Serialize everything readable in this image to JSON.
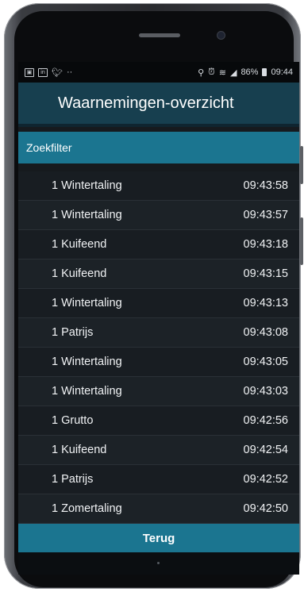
{
  "status_bar": {
    "left_icons": [
      "gallery-icon",
      "linkedin-icon",
      "twitter-icon",
      "more-icon"
    ],
    "right_icons": [
      "location-icon",
      "alarm-icon",
      "wifi-icon",
      "signal-icon"
    ],
    "battery": "86%",
    "time": "09:44"
  },
  "app": {
    "title": "Waarnemingen-overzicht",
    "filter_label": "Zoekfilter",
    "back_label": "Terug"
  },
  "observations": [
    {
      "name": "1 Wintertaling",
      "time": "09:43:58"
    },
    {
      "name": "1 Wintertaling",
      "time": "09:43:57"
    },
    {
      "name": "1 Kuifeend",
      "time": "09:43:18"
    },
    {
      "name": "1 Kuifeend",
      "time": "09:43:15"
    },
    {
      "name": "1 Wintertaling",
      "time": "09:43:13"
    },
    {
      "name": "1 Patrijs",
      "time": "09:43:08"
    },
    {
      "name": "1 Wintertaling",
      "time": "09:43:05"
    },
    {
      "name": "1 Wintertaling",
      "time": "09:43:03"
    },
    {
      "name": "1 Grutto",
      "time": "09:42:56"
    },
    {
      "name": "1 Kuifeend",
      "time": "09:42:54"
    },
    {
      "name": "1 Patrijs",
      "time": "09:42:52"
    },
    {
      "name": "1 Zomertaling",
      "time": "09:42:50"
    }
  ],
  "colors": {
    "appbar": "#173f4f",
    "accent": "#1b7590",
    "list_bg": "#181d22"
  }
}
